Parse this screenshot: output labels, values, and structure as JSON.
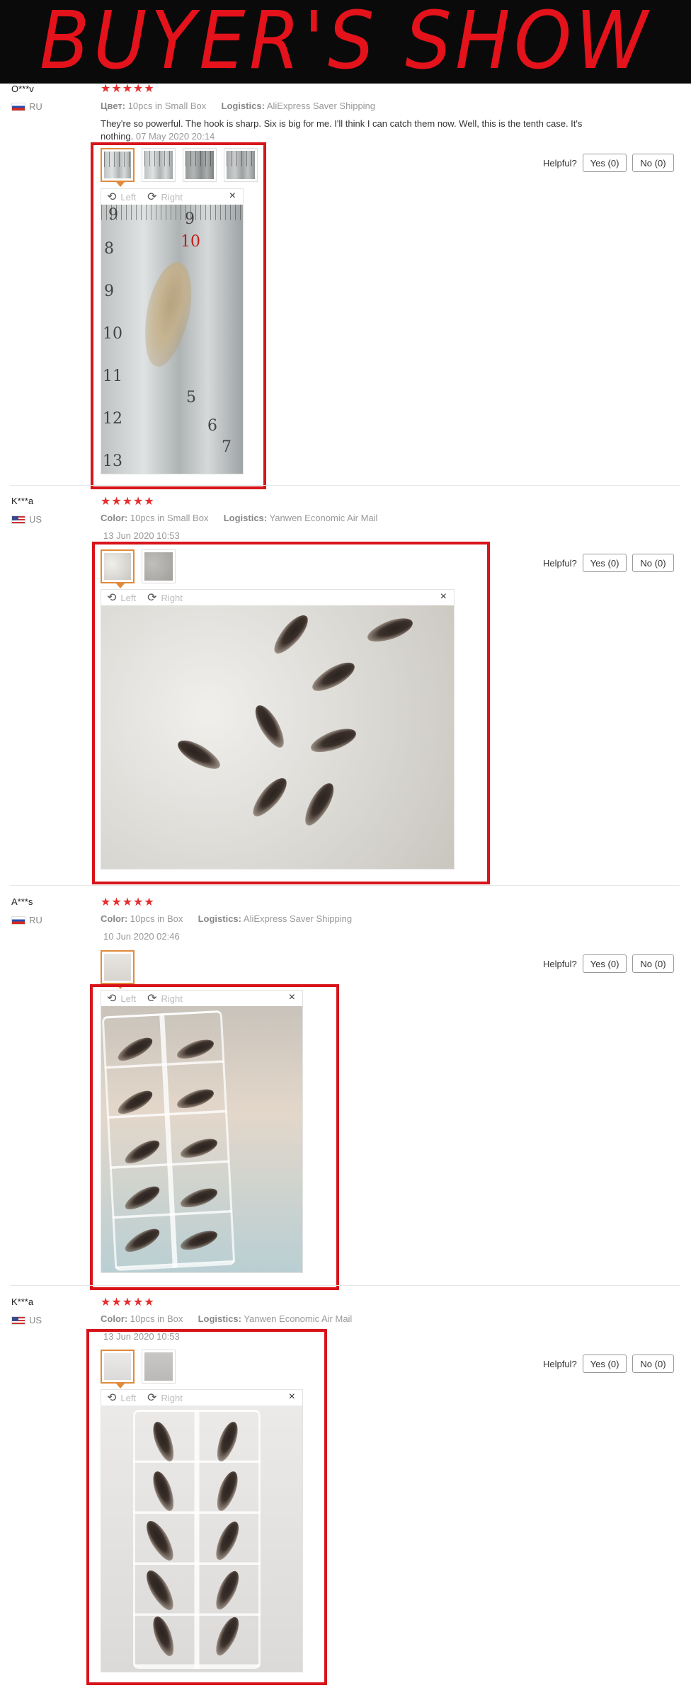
{
  "banner": {
    "title": "BUYER'S SHOW"
  },
  "labels": {
    "helpful": "Helpful?",
    "left": "Left",
    "right": "Right",
    "close": "×"
  },
  "reviews": [
    {
      "user": "O***v",
      "country": "RU",
      "rating": "★★★★★",
      "attr_label": "Цвет:",
      "attr_value": "10pcs in Small Box",
      "logistics_label": "Logistics:",
      "logistics_value": "AliExpress Saver Shipping",
      "text": "They're so powerful. The hook is sharp. Six is big for me. I'll think I can catch them now. Well, this is the tenth case. It's nothing.",
      "date": "07 May 2020 20:14",
      "yes": "Yes (0)",
      "no": "No (0)"
    },
    {
      "user": "K***a",
      "country": "US",
      "rating": "★★★★★",
      "attr_label": "Color:",
      "attr_value": "10pcs in Small Box",
      "logistics_label": "Logistics:",
      "logistics_value": "Yanwen Economic Air Mail",
      "date": "13 Jun 2020 10:53",
      "yes": "Yes (0)",
      "no": "No (0)"
    },
    {
      "user": "A***s",
      "country": "RU",
      "rating": "★★★★★",
      "attr_label": "Color:",
      "attr_value": "10pcs in Box",
      "logistics_label": "Logistics:",
      "logistics_value": "AliExpress Saver Shipping",
      "date": "10 Jun 2020 02:46",
      "yes": "Yes (0)",
      "no": "No (0)"
    },
    {
      "user": "K***a",
      "country": "US",
      "rating": "★★★★★",
      "attr_label": "Color:",
      "attr_value": "10pcs in Box",
      "logistics_label": "Logistics:",
      "logistics_value": "Yanwen Economic Air Mail",
      "date": "13 Jun 2020 10:53",
      "yes": "Yes (0)",
      "no": "No (0)"
    }
  ],
  "ruler_marks": [
    "9",
    "10",
    "1",
    "8",
    "9",
    "10",
    "11",
    "12",
    "13",
    "5",
    "6",
    "7"
  ]
}
